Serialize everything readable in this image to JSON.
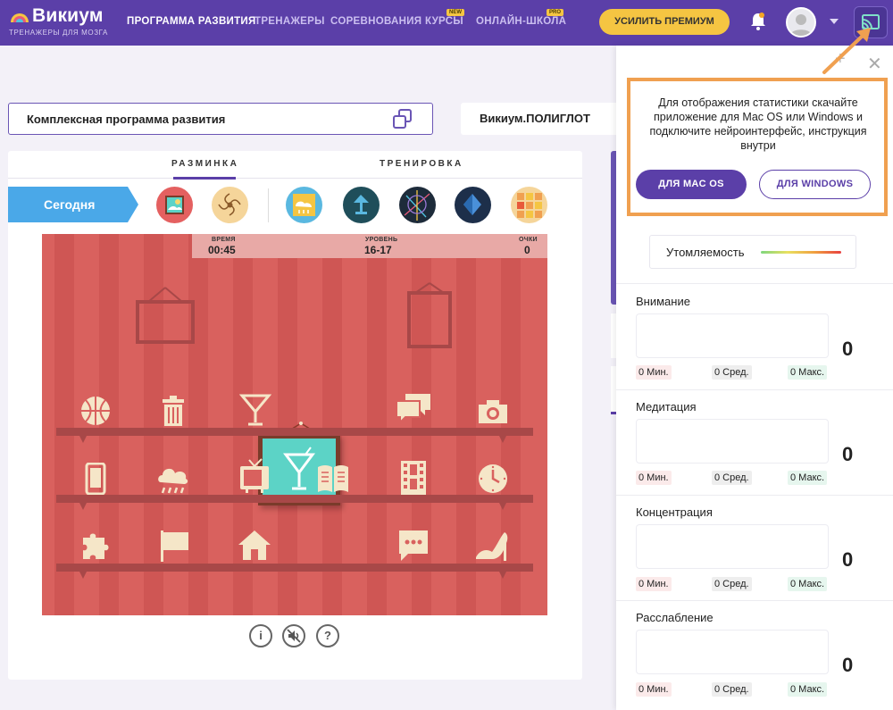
{
  "header": {
    "logo": "Викиум",
    "logo_sub": "ТРЕНАЖЕРЫ ДЛЯ МОЗГА",
    "nav": [
      {
        "label": "ПРОГРАММА РАЗВИТИЯ",
        "active": true
      },
      {
        "label": "ТРЕНАЖЕРЫ"
      },
      {
        "label": "СОРЕВНОВАНИЯ"
      },
      {
        "label": "КУРСЫ",
        "tag": "NEW"
      },
      {
        "label": "ОНЛАЙН-ШКОЛА",
        "tag": "PRO"
      }
    ],
    "premium_button": "УСИЛИТЬ ПРЕМИУМ",
    "accent_color": "#5b3fa8",
    "premium_color": "#f5c542"
  },
  "program": {
    "label": "Комплексная программа развития",
    "polyglot_label": "Викиум.ПОЛИГЛОТ"
  },
  "training": {
    "tabs": [
      "РАЗМИНКА",
      "ТРЕНИРОВКА"
    ],
    "active_tab": "РАЗМИНКА",
    "today_label": "Сегодня",
    "game_icons": [
      "weather-icon",
      "spiral-icon",
      "rain-cloud-icon",
      "lamp-icon",
      "geometry-icon",
      "compass-icon",
      "grid-icon"
    ]
  },
  "game": {
    "time_label": "ВРЕМЯ",
    "time_value": "00:45",
    "level_label": "УРОВЕНЬ",
    "level_value": "16-17",
    "score_label": "ОЧКИ",
    "score_value": "0",
    "target_icon": "cocktail-icon",
    "shelf_icons": [
      [
        "basketball-icon",
        "trash-icon",
        "cocktail-icon",
        "chat-icon",
        "camera-icon"
      ],
      [
        "phone-icon",
        "rain-cloud-icon",
        "tv-icon",
        "book-icon",
        "film-icon",
        "clock-icon"
      ],
      [
        "puzzle-icon",
        "flag-icon",
        "house-icon",
        "message-icon",
        "heel-shoe-icon"
      ]
    ]
  },
  "controls": [
    "i",
    "?"
  ],
  "panel": {
    "notice": "Для отображения статистики скачайте приложение для Mac OS или Windows и подключите нейроинтерфейс, инструкция внутри",
    "mac_button": "ДЛЯ MAC OS",
    "win_button": "ДЛЯ WINDOWS",
    "fatigue_label": "Утомляемость",
    "highlight_color": "#f0a050",
    "metrics": [
      {
        "name": "Внимание",
        "value": "0",
        "min": "0 Мин.",
        "avg": "0 Сред.",
        "max": "0 Макс."
      },
      {
        "name": "Медитация",
        "value": "0",
        "min": "0 Мин.",
        "avg": "0 Сред.",
        "max": "0 Макс."
      },
      {
        "name": "Концентрация",
        "value": "0",
        "min": "0 Мин.",
        "avg": "0 Сред.",
        "max": "0 Макс."
      },
      {
        "name": "Расслабление",
        "value": "0",
        "min": "0 Мин.",
        "avg": "0 Сред.",
        "max": "0 Макс."
      }
    ]
  }
}
